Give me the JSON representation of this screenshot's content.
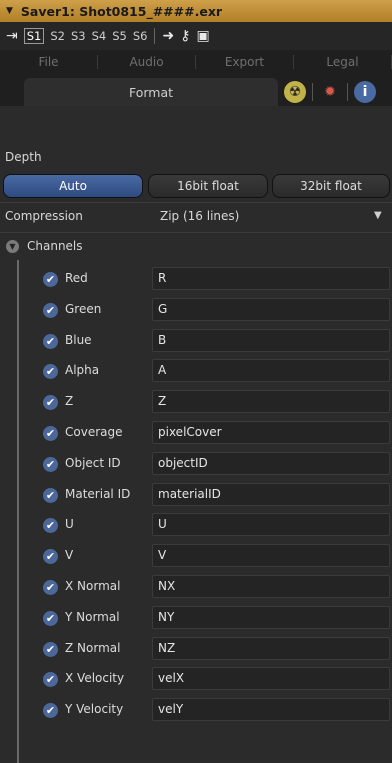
{
  "title": "Saver1: Shot0815_####.exr",
  "toolbar": {
    "slots": [
      "S1",
      "S2",
      "S3",
      "S4",
      "S5",
      "S6"
    ],
    "active_slot": "S1"
  },
  "tabs_top": [
    "File",
    "Audio",
    "Export",
    "Legal"
  ],
  "tab_active": "Format",
  "depth": {
    "label": "Depth",
    "options": [
      "Auto",
      "16bit float",
      "32bit float"
    ],
    "selected": "Auto"
  },
  "compression": {
    "label": "Compression",
    "value": "Zip (16 lines)"
  },
  "channels": {
    "label": "Channels",
    "items": [
      {
        "label": "Red",
        "value": "R"
      },
      {
        "label": "Green",
        "value": "G"
      },
      {
        "label": "Blue",
        "value": "B"
      },
      {
        "label": "Alpha",
        "value": "A"
      },
      {
        "label": "Z",
        "value": "Z"
      },
      {
        "label": "Coverage",
        "value": "pixelCover"
      },
      {
        "label": "Object ID",
        "value": "objectID"
      },
      {
        "label": "Material ID",
        "value": "materialID"
      },
      {
        "label": "U",
        "value": "U"
      },
      {
        "label": "V",
        "value": "V"
      },
      {
        "label": "X Normal",
        "value": "NX"
      },
      {
        "label": "Y Normal",
        "value": "NY"
      },
      {
        "label": "Z Normal",
        "value": "NZ"
      },
      {
        "label": "X Velocity",
        "value": "velX"
      },
      {
        "label": "Y Velocity",
        "value": "velY"
      }
    ]
  },
  "colors": {
    "title_bar": "#b88a33",
    "accent": "#3b5a93",
    "checkbox": "#4c6799"
  }
}
